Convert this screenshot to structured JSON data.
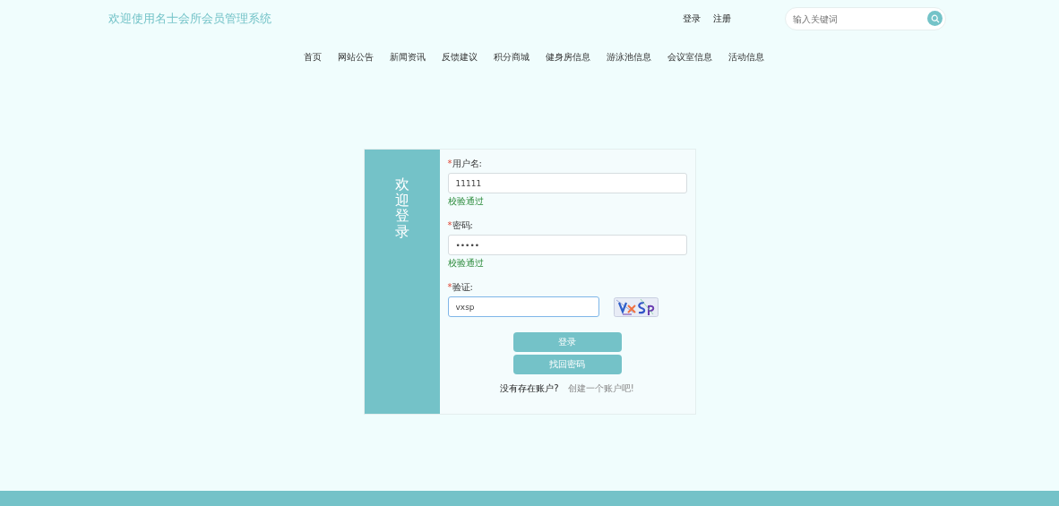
{
  "header": {
    "title": "欢迎使用名士会所会员管理系统",
    "links": [
      "登录",
      "注册"
    ],
    "search": {
      "placeholder": "输入关键词"
    }
  },
  "nav": [
    {
      "label": "首页"
    },
    {
      "label": "网站公告"
    },
    {
      "label": "新闻资讯"
    },
    {
      "label": "反馈建议"
    },
    {
      "label": "积分商城"
    },
    {
      "label": "健身房信息"
    },
    {
      "label": "游泳池信息"
    },
    {
      "label": "会议室信息"
    },
    {
      "label": "活动信息"
    }
  ],
  "login": {
    "side_title": "欢迎登录",
    "fields": [
      {
        "kind": "text",
        "label": "用户名:",
        "required_mark": "*",
        "value": "11111",
        "hint": "校验通过"
      },
      {
        "kind": "password",
        "label": "密码:",
        "required_mark": "*",
        "value": "•••••",
        "hint": "校验通过"
      },
      {
        "kind": "captcha",
        "label": "验证:",
        "required_mark": "*",
        "value": "vxsp",
        "focused": true
      }
    ],
    "buttons": [
      "登录",
      "找回密码"
    ],
    "footer": {
      "text": "没有存在账户?",
      "link": "创建一个账户吧!"
    }
  }
}
